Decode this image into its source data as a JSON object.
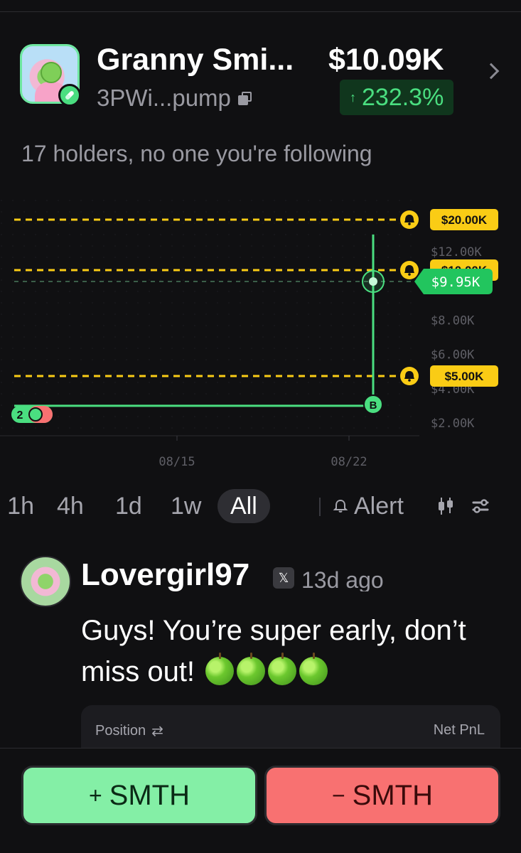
{
  "token": {
    "name": "Granny Smi...",
    "address": "3PWi...pump",
    "price": "$10.09K",
    "change": "232.3%",
    "holders_text": "17 holders, no one you're following"
  },
  "chart_data": {
    "type": "line",
    "x_tick_labels": [
      "08/15",
      "08/22"
    ],
    "y_tick_labels": [
      "$2.00K",
      "$4.00K",
      "$6.00K",
      "$8.00K",
      "$10.00K",
      "$12.00K"
    ],
    "current_price_label": "$9.95K",
    "alerts": [
      "$20.00K",
      "$10.00K",
      "$5.00K"
    ],
    "markers": {
      "holders_badge": "2",
      "buy_marker": "B"
    },
    "series": [
      {
        "x": [
          "08/10",
          "08/23",
          "08/23",
          "08/23"
        ],
        "y": [
          3.0,
          3.0,
          9.95,
          13.0
        ]
      }
    ],
    "colors": {
      "line": "#4ade80",
      "alert": "#facc15",
      "current": "#22c55e"
    }
  },
  "timeframes": [
    "1h",
    "4h",
    "1d",
    "1w",
    "All"
  ],
  "active_timeframe": "All",
  "alert_label": "Alert",
  "post": {
    "user": "Lovergirl97",
    "platform": "X",
    "time": "13d ago",
    "text": "Guys! You’re super early, don’t miss out!",
    "emoji_count": 4,
    "position_label": "Position",
    "pnl_label": "Net PnL"
  },
  "actions": {
    "buy_label": "SMTH",
    "buy_sign": "+",
    "sell_label": "SMTH",
    "sell_sign": "−"
  }
}
